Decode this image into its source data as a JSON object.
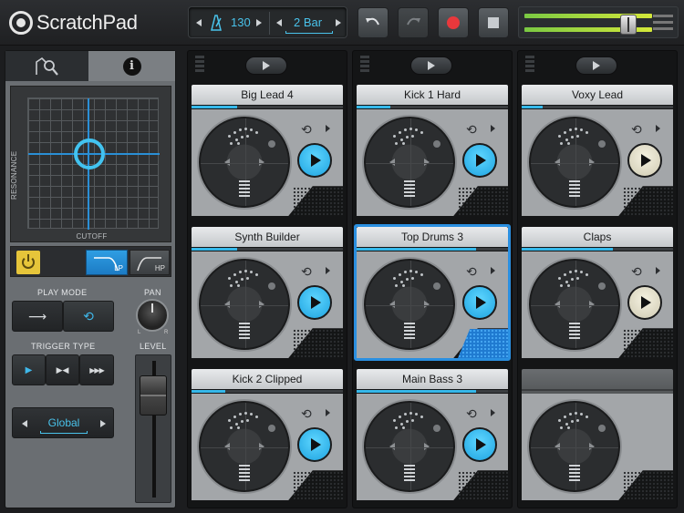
{
  "app": {
    "name": "ScratchPad"
  },
  "transport": {
    "tempo": "130",
    "bar_length": "2 Bar"
  },
  "filter_panel": {
    "y_axis_label": "RESONANCE",
    "x_axis_label": "CUTOFF",
    "lp_label": "LP",
    "hp_label": "HP"
  },
  "controls": {
    "play_mode_label": "PLAY MODE",
    "pan_label": "PAN",
    "pan_left": "L",
    "pan_right": "R",
    "trigger_type_label": "TRIGGER TYPE",
    "level_label": "LEVEL",
    "sync_value": "Global"
  },
  "colors": {
    "accent_blue": "#35b8ea",
    "record_red": "#e8383c",
    "power_yellow": "#e6c53a",
    "selected_border": "#2a8fe0"
  },
  "columns": [
    {
      "clips": [
        {
          "name": "Big Lead 4",
          "progress": 0.3,
          "play_state": "blue"
        },
        {
          "name": "Synth Builder",
          "progress": 0.3,
          "play_state": "blue"
        },
        {
          "name": "Kick 2 Clipped",
          "progress": 0.22,
          "play_state": "blue"
        }
      ]
    },
    {
      "clips": [
        {
          "name": "Kick 1 Hard",
          "progress": 0.22,
          "play_state": "blue"
        },
        {
          "name": "Top Drums 3",
          "progress": 0.79,
          "play_state": "blue",
          "selected": true
        },
        {
          "name": "Main Bass 3",
          "progress": 0.79,
          "play_state": "blue"
        }
      ]
    },
    {
      "clips": [
        {
          "name": "Voxy Lead",
          "progress": 0.14,
          "play_state": "cream"
        },
        {
          "name": "Claps",
          "progress": 0.6,
          "play_state": "cream"
        },
        {
          "name": "",
          "progress": 0,
          "empty": true
        }
      ]
    }
  ]
}
